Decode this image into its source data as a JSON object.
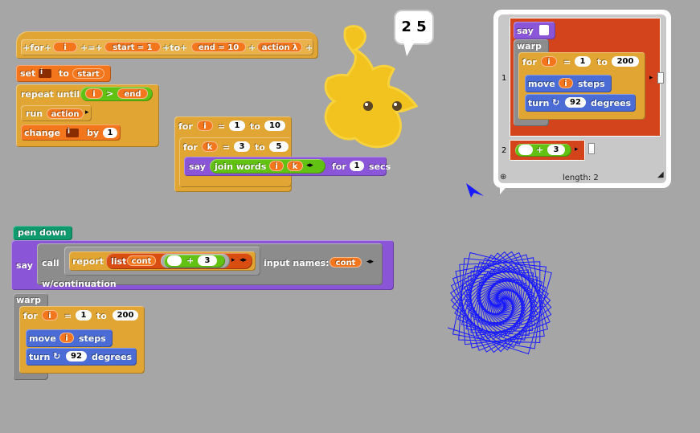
{
  "custom_for": {
    "hat_labels": [
      "+for+",
      "i",
      "+=+",
      "start = 1",
      "+to+",
      "end = 10",
      "+",
      "action λ",
      "+"
    ],
    "set_label": "set",
    "set_var": "i",
    "to_label": "to",
    "set_value": "start",
    "repeat_label": "repeat until",
    "cond_left": "i",
    "cond_op": ">",
    "cond_right": "end",
    "run_label": "run",
    "run_arg": "action",
    "change_label": "change",
    "change_var": "i",
    "by_label": "by",
    "by_value": "1"
  },
  "nested_for": {
    "for_label": "for",
    "outer_var": "i",
    "eq": "=",
    "outer_from": "1",
    "to_label": "to",
    "outer_to": "10",
    "inner_var": "k",
    "inner_from": "3",
    "inner_to": "5",
    "say_label": "say",
    "join_label": "join words",
    "join_a": "i",
    "join_b": "k",
    "for_secs_label": "for",
    "secs_value": "1",
    "secs_label": "secs"
  },
  "sprite": {
    "speech": "2 5"
  },
  "pen_script": {
    "pen_down_label": "pen down",
    "say_label": "say",
    "call_label": "call",
    "report_label": "report",
    "list_label": "list",
    "list_arg": "cont",
    "plus_op": "+",
    "plus_value": "3",
    "input_names_label": "input names:",
    "input_name": "cont",
    "continuation_label": "w/continuation",
    "warp_label": "warp",
    "for_label": "for",
    "for_var": "i",
    "eq": "=",
    "from": "1",
    "to_label": "to",
    "to": "200",
    "move_label": "move",
    "move_arg": "i",
    "steps_label": "steps",
    "turn_label": "turn",
    "turn_value": "92",
    "degrees_label": "degrees"
  },
  "list_watcher": {
    "row1_index": "1",
    "row2_index": "2",
    "say_label": "say",
    "warp_label": "warp",
    "for_label": "for",
    "for_var": "i",
    "eq": "=",
    "from": "1",
    "to_label": "to",
    "to": "200",
    "move_label": "move",
    "move_arg": "i",
    "steps_label": "steps",
    "turn_label": "turn",
    "turn_value": "92",
    "degrees_label": "degrees",
    "plus_op": "+",
    "plus_value": "3",
    "length_label": "length: 2"
  },
  "drawing": {
    "pen_color": "#1a1aff",
    "turn_degrees": 92,
    "step_count": 200
  },
  "colors": {
    "background": "#a6a6a6",
    "control": "#e1a533",
    "variables": "#f3761d",
    "operators": "#62c213",
    "motion": "#4a6cd4",
    "looks": "#8a55d7",
    "pen": "#0e9a6c",
    "lists": "#d94d11"
  }
}
